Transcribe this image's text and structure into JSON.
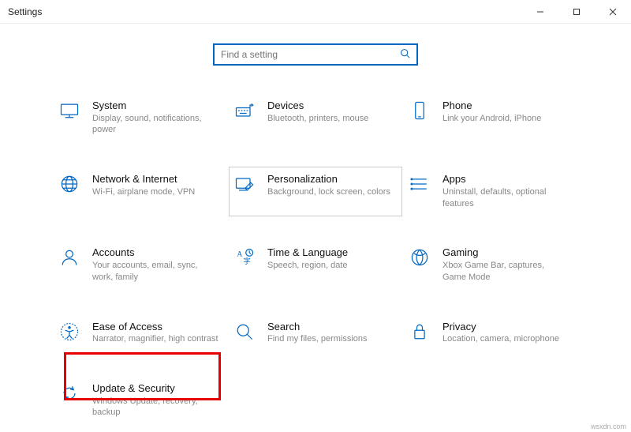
{
  "window": {
    "title": "Settings"
  },
  "search": {
    "placeholder": "Find a setting"
  },
  "tiles": {
    "system": {
      "label": "System",
      "desc": "Display, sound, notifications, power"
    },
    "devices": {
      "label": "Devices",
      "desc": "Bluetooth, printers, mouse"
    },
    "phone": {
      "label": "Phone",
      "desc": "Link your Android, iPhone"
    },
    "network": {
      "label": "Network & Internet",
      "desc": "Wi-Fi, airplane mode, VPN"
    },
    "personalization": {
      "label": "Personalization",
      "desc": "Background, lock screen, colors"
    },
    "apps": {
      "label": "Apps",
      "desc": "Uninstall, defaults, optional features"
    },
    "accounts": {
      "label": "Accounts",
      "desc": "Your accounts, email, sync, work, family"
    },
    "time": {
      "label": "Time & Language",
      "desc": "Speech, region, date"
    },
    "gaming": {
      "label": "Gaming",
      "desc": "Xbox Game Bar, captures, Game Mode"
    },
    "ease": {
      "label": "Ease of Access",
      "desc": "Narrator, magnifier, high contrast"
    },
    "search": {
      "label": "Search",
      "desc": "Find my files, permissions"
    },
    "privacy": {
      "label": "Privacy",
      "desc": "Location, camera, microphone"
    },
    "update": {
      "label": "Update & Security",
      "desc": "Windows Update, recovery, backup"
    }
  },
  "watermark": "wsxdn.com"
}
